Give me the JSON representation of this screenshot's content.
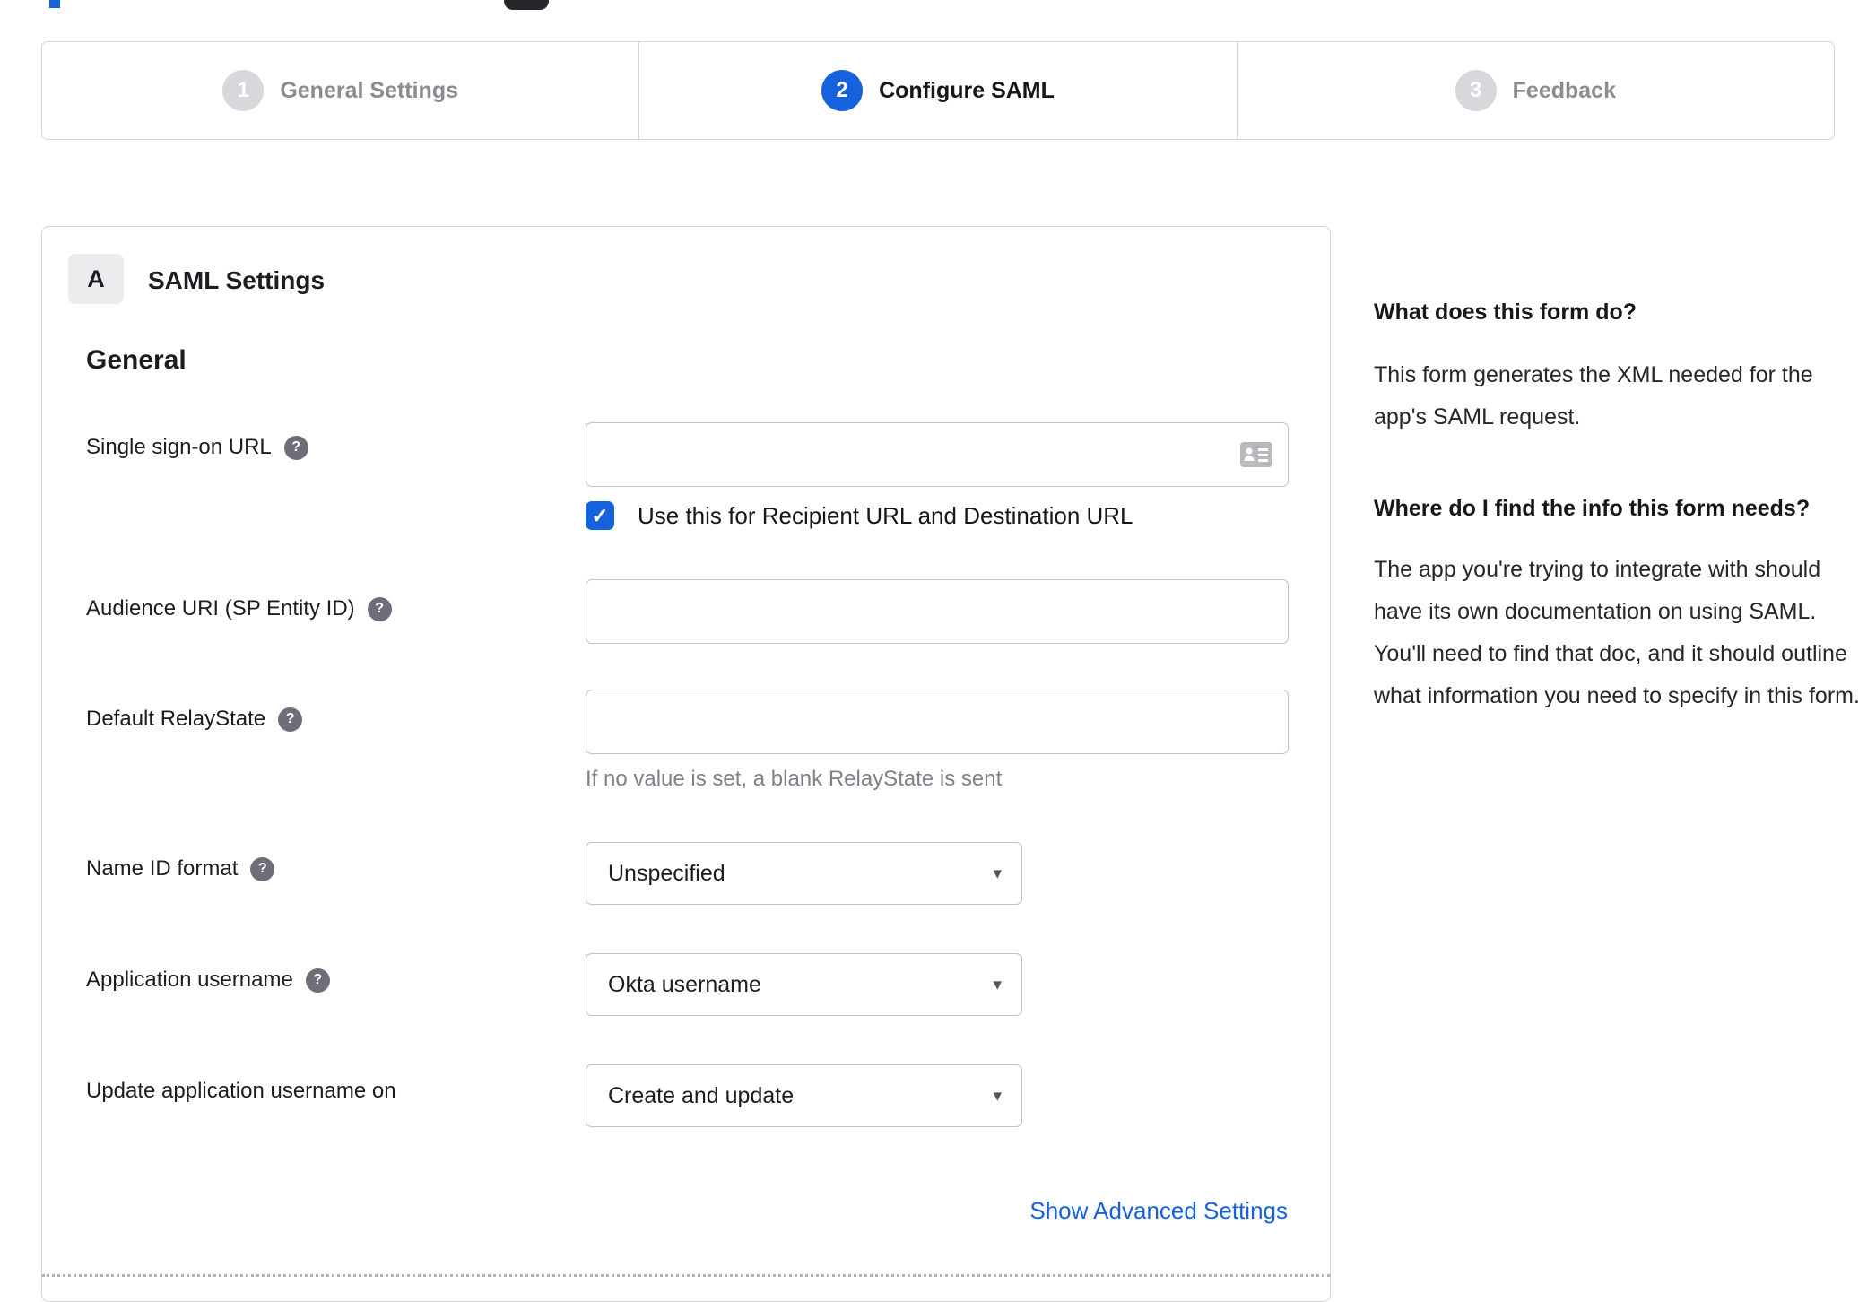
{
  "stepper": {
    "active_step": "2",
    "steps": [
      {
        "number": "1",
        "label": "General Settings"
      },
      {
        "number": "2",
        "label": "Configure SAML"
      },
      {
        "number": "3",
        "label": "Feedback"
      }
    ]
  },
  "panel": {
    "badge": "A",
    "title": "SAML Settings",
    "group": "General",
    "advanced_link": "Show Advanced Settings"
  },
  "fields": {
    "sso": {
      "label": "Single sign-on URL",
      "value": "",
      "checkbox": {
        "label": "Use this for Recipient URL and Destination URL",
        "checked": true
      }
    },
    "audience": {
      "label": "Audience URI (SP Entity ID)",
      "value": ""
    },
    "relay": {
      "label": "Default RelayState",
      "value": "",
      "helper": "If no value is set, a blank RelayState is sent"
    },
    "nameid": {
      "label": "Name ID format",
      "value": "Unspecified"
    },
    "appuser": {
      "label": "Application username",
      "value": "Okta username"
    },
    "updateuser": {
      "label": "Update application username on",
      "value": "Create and update"
    }
  },
  "sidebar": {
    "sections": [
      {
        "heading": "What does this form do?",
        "body": "This form generates the XML needed for the app's SAML request."
      },
      {
        "heading": "Where do I find the info this form needs?",
        "body": "The app you're trying to integrate with should have its own documentation on using SAML. You'll need to find that doc, and it should outline what information you need to specify in this form."
      }
    ]
  },
  "icons": {
    "help": "?",
    "check": "✓",
    "dropdown": "▾"
  },
  "colors": {
    "accent": "#1662dd",
    "inactive_step": "#d8d8dc",
    "muted_text": "#8b8b91"
  }
}
